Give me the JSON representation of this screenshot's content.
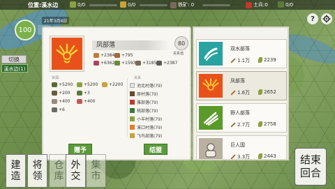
{
  "top_bar": {
    "location": "位置:溪水边",
    "res1": "0/0",
    "res2": "0/0",
    "res3": "铁矿: 0",
    "soldiers": "士兵:0",
    "res4": "0/0"
  },
  "hud": {
    "gauge_value": "100",
    "date": "21年3月4日",
    "switch_label": "切换",
    "location_button": "溪水边(1)"
  },
  "top_right": {
    "help_icon": "?",
    "settings_icon": "gear-icon"
  },
  "faction": {
    "name": "凤部落",
    "score": "80",
    "score_label": "关系值",
    "color": "#e8521a",
    "stats": [
      {
        "icon": "troop-icon",
        "value": "+2384",
        "color": "#c07a3a"
      },
      {
        "icon": "spear-icon",
        "value": "+795",
        "color": "#a06a3a"
      },
      {
        "icon": "food-icon",
        "value": "+6362",
        "color": "#b04060"
      },
      {
        "icon": "bow-icon",
        "value": "+1593",
        "color": "#6a8a3a"
      },
      {
        "icon": "sword-icon",
        "value": "+3185",
        "color": "#7a6a5a"
      },
      {
        "icon": "cavalry-icon",
        "value": "+2387",
        "color": "#5a5a5a"
      }
    ],
    "resources_label": "资源:",
    "resources": [
      {
        "value": "+5200",
        "color": "#556b2f"
      },
      {
        "value": "+5200",
        "color": "#8aa23e"
      },
      {
        "value": "+2200",
        "color": "#c9a33a"
      },
      {
        "value": "+200",
        "color": "#6b5a3a"
      },
      {
        "value": "+3",
        "color": "#5a7a3a"
      },
      {
        "value": "+400",
        "color": "#9a8a7a"
      },
      {
        "value": "+400",
        "color": "#c05a5a"
      },
      {
        "value": "+6",
        "color": "#6a6a6a"
      }
    ],
    "relations_label": "关系",
    "relations": [
      {
        "name": "池北村落(79)",
        "color": "#e5e3dc"
      },
      {
        "name": "原村落(79)",
        "color": "#6b4a2a"
      },
      {
        "name": "雅部落(79)",
        "color": "#c0392b"
      },
      {
        "name": "桃部落(79)",
        "color": "#3a7a3a"
      },
      {
        "name": "小羊村落(79)",
        "color": "#8aa23e"
      },
      {
        "name": "溪口村落(79)",
        "color": "#e67e22"
      },
      {
        "name": "飞鸟部落(79)",
        "color": "#c9a33a"
      }
    ],
    "gift_button": "赠予",
    "alliance_button": "结盟"
  },
  "tribe_list": [
    {
      "name": "双水部落",
      "strength": "1.1万",
      "population": "2239",
      "color": "#2aa3a0",
      "emblem": "wave-icon",
      "selected": false
    },
    {
      "name": "凤部落",
      "strength": "1.6万",
      "population": "2652",
      "color": "#e8521a",
      "emblem": "phoenix-icon",
      "selected": true
    },
    {
      "name": "野人部落",
      "strength": "2.7万",
      "population": "2758",
      "color": "#5a9a2a",
      "emblem": "claw-icon",
      "selected": false
    },
    {
      "name": "巨人国",
      "strength": "3.3万",
      "population": "2443",
      "color": "#b8b0a0",
      "emblem": "giant-icon",
      "selected": false
    }
  ],
  "bottom_buttons": [
    {
      "label": "建造",
      "enabled": true
    },
    {
      "label": "将领",
      "enabled": true
    },
    {
      "label": "仓库",
      "enabled": false
    },
    {
      "label": "外交",
      "enabled": true
    },
    {
      "label": "集市",
      "enabled": false
    }
  ],
  "end_turn": "结束回合"
}
